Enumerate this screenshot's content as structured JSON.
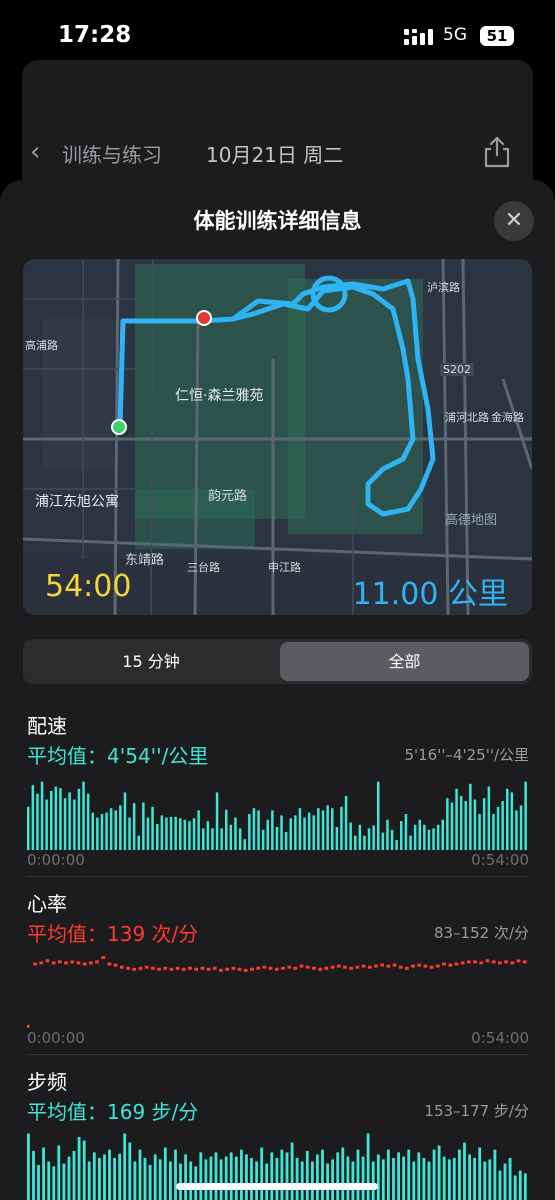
{
  "status": {
    "time": "17:28",
    "network": "5G",
    "battery": "51"
  },
  "background_nav": {
    "back_label": "训练与练习",
    "date": "10月21日 周二"
  },
  "sheet": {
    "title": "体能训练详细信息"
  },
  "map": {
    "duration": "54:00",
    "distance": "11.00 公里",
    "pois": [
      "仁恒·森兰雅苑",
      "浦江东旭公寓"
    ],
    "roads": [
      "东靖路",
      "韵元路",
      "高浦路",
      "S202",
      "三台路",
      "金海路",
      "浦河北路",
      "申江路",
      "泸滨路",
      "高德地图"
    ]
  },
  "segment": {
    "options": [
      "15 分钟",
      "全部"
    ],
    "selected": "全部"
  },
  "pace": {
    "heading": "配速",
    "avg": "平均值：4'54''/公里",
    "range": "5'16''–4'25''/公里",
    "start": "0:00:00",
    "end": "0:54:00",
    "color": "#3ee6d6",
    "bars": [
      0.6,
      0.9,
      0.78,
      0.95,
      0.7,
      0.82,
      0.88,
      0.86,
      0.72,
      0.8,
      0.7,
      0.85,
      0.95,
      0.78,
      0.52,
      0.45,
      0.5,
      0.52,
      0.58,
      0.55,
      0.62,
      0.8,
      0.45,
      0.65,
      0.2,
      0.66,
      0.45,
      0.6,
      0.36,
      0.48,
      0.45,
      0.46,
      0.46,
      0.44,
      0.42,
      0.4,
      0.44,
      0.55,
      0.3,
      0.4,
      0.3,
      0.8,
      0.3,
      0.56,
      0.35,
      0.45,
      0.3,
      0.15,
      0.5,
      0.58,
      0.55,
      0.28,
      0.42,
      0.55,
      0.32,
      0.48,
      0.25,
      0.44,
      0.48,
      0.58,
      0.45,
      0.52,
      0.48,
      0.58,
      0.55,
      0.62,
      0.58,
      0.32,
      0.6,
      0.75,
      0.38,
      0.2,
      0.35,
      0.2,
      0.3,
      0.34,
      0.95,
      0.24,
      0.42,
      0.28,
      0.14,
      0.4,
      0.5,
      0.2,
      0.35,
      0.42,
      0.35,
      0.28,
      0.3,
      0.35,
      0.42,
      0.72,
      0.66,
      0.85,
      0.75,
      0.68,
      0.92,
      0.7,
      0.5,
      0.72,
      0.88,
      0.5,
      0.6,
      0.68,
      0.85,
      0.8,
      0.55,
      0.62,
      0.95
    ]
  },
  "heart_rate": {
    "heading": "心率",
    "avg": "平均值：139 次/分",
    "range": "83–152 次/分",
    "start": "0:00:00",
    "end": "0:54:00",
    "color": "#ff3b2f",
    "points": [
      83,
      140,
      141,
      143,
      141,
      142,
      141,
      142,
      141,
      140,
      141,
      142,
      146,
      140,
      139,
      137,
      136,
      135,
      136,
      137,
      136,
      135,
      136,
      135,
      136,
      135,
      136,
      135,
      136,
      135,
      136,
      134,
      135,
      136,
      135,
      134,
      135,
      136,
      137,
      136,
      135,
      136,
      137,
      136,
      138,
      137,
      136,
      135,
      136,
      137,
      138,
      137,
      136,
      137,
      138,
      137,
      138,
      139,
      138,
      139,
      137,
      136,
      138,
      139,
      138,
      137,
      138,
      140,
      139,
      140,
      141,
      142,
      142,
      141,
      143,
      142,
      141,
      142,
      141,
      143,
      142
    ]
  },
  "cadence": {
    "heading": "步频",
    "avg": "平均值：169 步/分",
    "range": "153–177 步/分",
    "color": "#3ee6d6",
    "bars": [
      0.95,
      0.7,
      0.5,
      0.75,
      0.55,
      0.48,
      0.78,
      0.52,
      0.62,
      0.7,
      0.9,
      0.85,
      0.55,
      0.68,
      0.6,
      0.65,
      0.72,
      0.6,
      0.66,
      0.95,
      0.82,
      0.55,
      0.72,
      0.6,
      0.5,
      0.65,
      0.58,
      0.75,
      0.55,
      0.72,
      0.52,
      0.65,
      0.55,
      0.48,
      0.68,
      0.58,
      0.62,
      0.68,
      0.58,
      0.62,
      0.68,
      0.62,
      0.72,
      0.65,
      0.6,
      0.55,
      0.75,
      0.52,
      0.68,
      0.6,
      0.72,
      0.68,
      0.82,
      0.6,
      0.55,
      0.7,
      0.55,
      0.65,
      0.72,
      0.52,
      0.58,
      0.68,
      0.75,
      0.62,
      0.55,
      0.72,
      0.62,
      0.95,
      0.55,
      0.65,
      0.58,
      0.72,
      0.6,
      0.68,
      0.62,
      0.72,
      0.55,
      0.68,
      0.6,
      0.55,
      0.72,
      0.78,
      0.62,
      0.58,
      0.6,
      0.72,
      0.82,
      0.65,
      0.6,
      0.75,
      0.55,
      0.58,
      0.72,
      0.42,
      0.52,
      0.6,
      0.35,
      0.42,
      0.38
    ]
  }
}
